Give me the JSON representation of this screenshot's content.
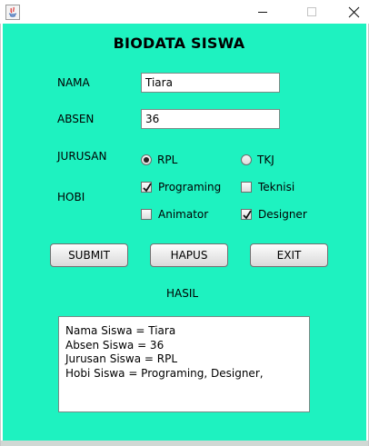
{
  "window": {
    "minimize_symbol": "—",
    "maximize_symbol": "□",
    "close_symbol": "✕"
  },
  "form": {
    "title": "BIODATA SISWA",
    "nama_label": "NAMA",
    "nama_value": "Tiara",
    "absen_label": "ABSEN",
    "absen_value": "36",
    "jurusan_label": "JURUSAN",
    "jurusan_options": [
      {
        "label": "RPL",
        "selected": true
      },
      {
        "label": "TKJ",
        "selected": false
      }
    ],
    "hobi_label": "HOBI",
    "hobi_options": [
      {
        "label": "Programing",
        "checked": true
      },
      {
        "label": "Teknisi",
        "checked": false
      },
      {
        "label": "Animator",
        "checked": false
      },
      {
        "label": "Designer",
        "checked": true
      }
    ],
    "buttons": {
      "submit": "SUBMIT",
      "hapus": "HAPUS",
      "exit": "EXIT"
    },
    "hasil_label": "HASIL",
    "hasil_lines": [
      "Nama Siswa = Tiara",
      "Absen Siswa = 36",
      "Jurusan Siswa = RPL",
      "Hobi Siswa = Programing, Designer,"
    ]
  },
  "colors": {
    "panel_background": "#1ef2c0"
  }
}
